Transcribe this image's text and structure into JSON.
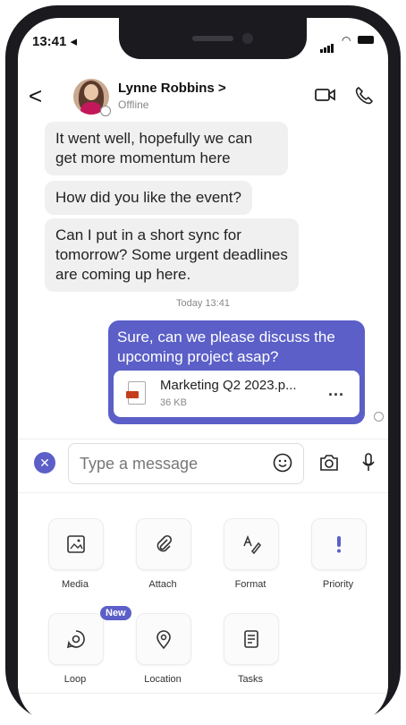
{
  "status_bar": {
    "time": "13:41 ◂"
  },
  "header": {
    "back": "<",
    "contact_name": "Lynne Robbins >",
    "contact_status": "Offline"
  },
  "messages": {
    "incoming": [
      {
        "text": "It went well, hopefully we can get more momentum here"
      },
      {
        "text": "How did you like the event?"
      },
      {
        "text": "Can I put in a short sync for tomorrow? Some urgent deadlines are coming up here."
      }
    ],
    "timestamp": "Today 13:41",
    "outgoing": {
      "text": "Sure, can we please discuss the upcoming project asap?",
      "attachment": {
        "name": "Marketing Q2 2023.p...",
        "size": "36 KB",
        "more": "..."
      }
    }
  },
  "composer": {
    "placeholder": "Type a message"
  },
  "actions": {
    "media": "Media",
    "attach": "Attach",
    "format": "Format",
    "priority": "Priority",
    "loop": "Loop",
    "loop_badge": "New",
    "location": "Location",
    "tasks": "Tasks"
  },
  "colors": {
    "accent": "#5b5fc7",
    "incoming_bubble": "#f0f0f0",
    "file_red": "#c43e1c"
  }
}
